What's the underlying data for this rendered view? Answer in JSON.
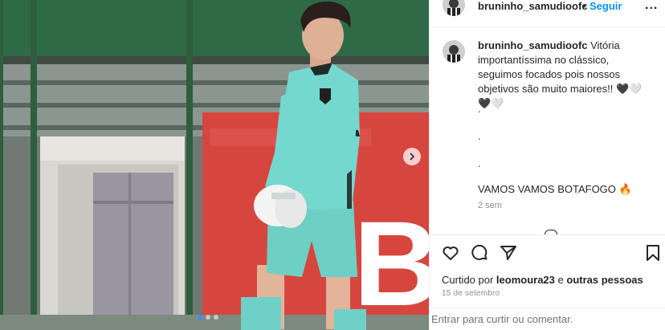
{
  "post": {
    "username": "bruninho_samudioofc",
    "separator": "•",
    "follow_label": "Seguir",
    "more_label": "...",
    "caption_user": "bruninho_samudioofc",
    "caption_text": " Vitória importantíssima no clássico, seguimos focados pois nossos objetivos são muito maiores!! 🖤🤍🖤🤍",
    "dot_lines": [
      ".",
      ".",
      "."
    ],
    "caption_line2": "VAMOS VAMOS BOTAFOGO 🔥",
    "time_ago": "2 sem",
    "liked_by_prefix": "Curtido por ",
    "liked_by_user": "leomoura23",
    "liked_by_mid": " e ",
    "liked_by_others": "outras pessoas",
    "date": "15 de setembro",
    "comment_placeholder": "Entrar para curtir ou comentar."
  },
  "carousel": {
    "current": 1,
    "total": 3
  },
  "icons": {
    "like": "heart-icon",
    "comment": "comment-icon",
    "share": "paper-plane-icon",
    "save": "bookmark-icon",
    "next": "chevron-right-icon",
    "more": "more-icon"
  },
  "colors": {
    "follow": "#0095f6",
    "muted": "#8e8e8e",
    "border": "#efefef",
    "jersey": "#74d8cf",
    "banner": "#d6463f"
  }
}
